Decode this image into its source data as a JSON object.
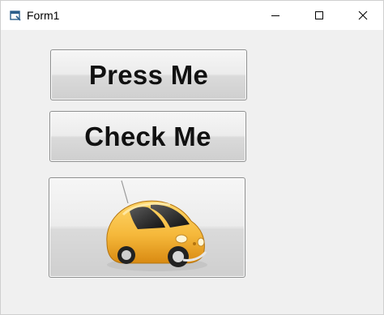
{
  "window": {
    "title": "Form1",
    "icon": "form-app-icon"
  },
  "caption_buttons": {
    "minimize_icon": "minimize-icon",
    "maximize_icon": "maximize-icon",
    "close_icon": "close-icon"
  },
  "form": {
    "press_button_label": "Press Me",
    "check_button_label": "Check Me",
    "image_button_icon": "yellow-car-icon"
  },
  "colors": {
    "client_background": "#f0f0f0",
    "titlebar_background": "#ffffff",
    "car_body": "#f5b83a"
  }
}
